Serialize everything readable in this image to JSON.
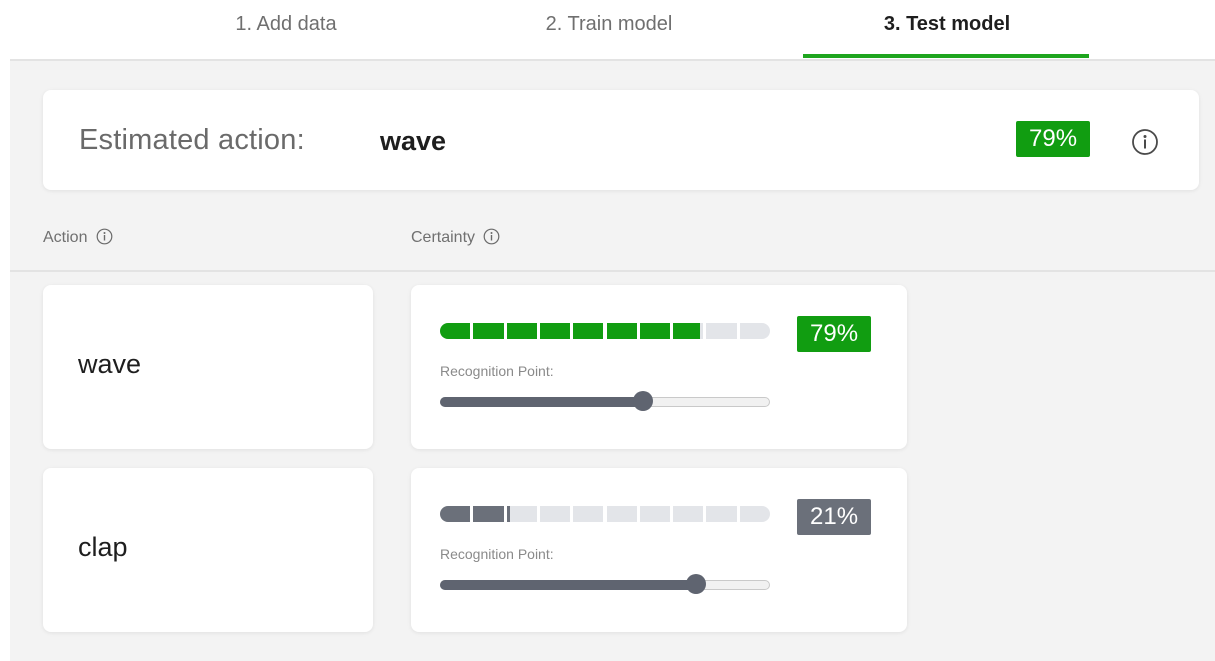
{
  "tabs": [
    {
      "label": "1. Add data",
      "active": false
    },
    {
      "label": "2. Train model",
      "active": false
    },
    {
      "label": "3. Test model",
      "active": true
    }
  ],
  "estimate": {
    "label": "Estimated action:",
    "value": "wave",
    "certainty": "79%",
    "info_icon": "info-circle-icon"
  },
  "columns": {
    "action": "Action",
    "certainty": "Certainty"
  },
  "actions": [
    {
      "name": "wave",
      "certainty": "79%",
      "certainty_value": 0.79,
      "recognition_point_label": "Recognition Point:",
      "recognition_point": 0.62,
      "color": "#119d11"
    },
    {
      "name": "clap",
      "certainty": "21%",
      "certainty_value": 0.21,
      "recognition_point_label": "Recognition Point:",
      "recognition_point": 0.78,
      "color": "#6b707a"
    }
  ],
  "colors": {
    "accent": "#1ea51e",
    "high_certainty": "#119d11",
    "low_certainty": "#6b707a",
    "bar_empty": "#e3e5e9",
    "background": "#f3f3f3"
  }
}
